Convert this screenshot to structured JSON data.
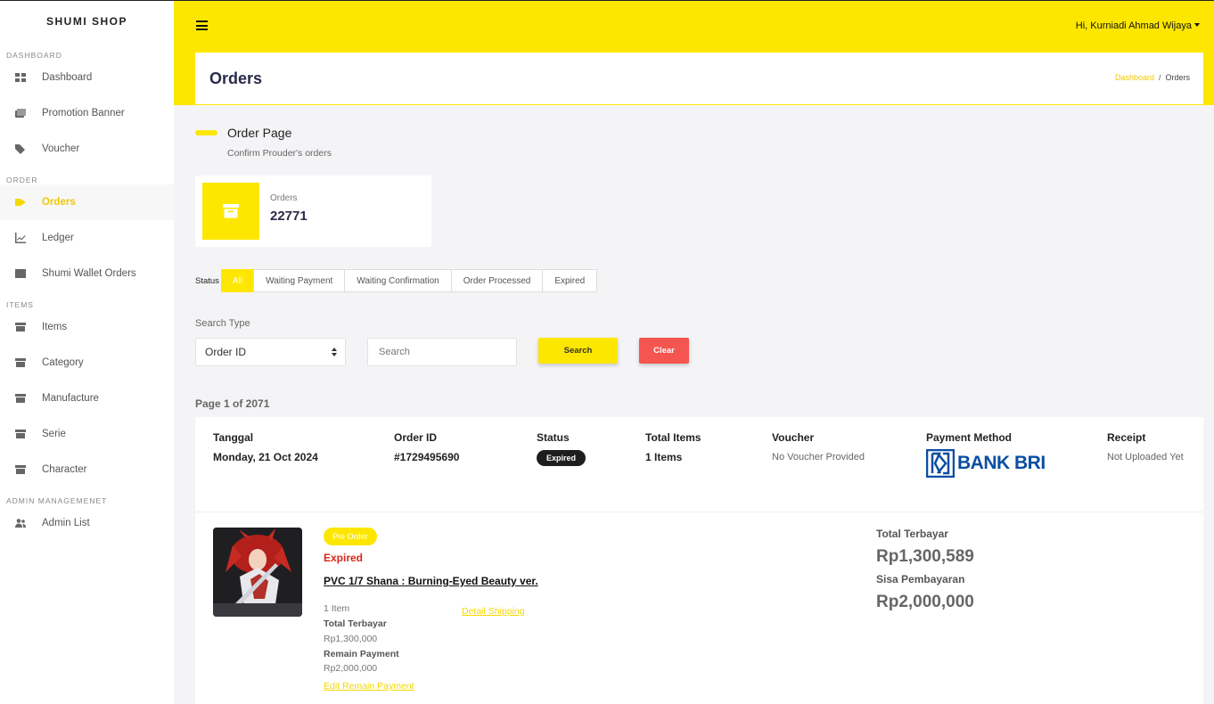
{
  "sidebar": {
    "brand": "SHUMI SHOP",
    "sections": {
      "dashboard": "DASHBOARD",
      "order": "ORDER",
      "items": "ITEMS",
      "admin": "ADMIN MANAGEMENET"
    },
    "items": {
      "dashboard": "Dashboard",
      "promotion_banner": "Promotion Banner",
      "voucher": "Voucher",
      "orders": "Orders",
      "ledger": "Ledger",
      "shumi_wallet_orders": "Shumi Wallet Orders",
      "items": "Items",
      "category": "Category",
      "manufacture": "Manufacture",
      "serie": "Serie",
      "character": "Character",
      "admin_list": "Admin List"
    }
  },
  "topbar": {
    "user_greeting": "Hi, Kurniadi Ahmad Wijaya"
  },
  "header": {
    "title": "Orders",
    "breadcrumb": {
      "home": "Dashboard",
      "sep": "/",
      "current": "Orders"
    }
  },
  "section": {
    "title": "Order Page",
    "subtitle": "Confirm Prouder's orders"
  },
  "stat": {
    "label": "Orders",
    "value": "22771"
  },
  "status_filter": {
    "label": "Status",
    "tabs": [
      "All",
      "Waiting Payment",
      "Waiting Confirmation",
      "Order Processed",
      "Expired"
    ],
    "selected": "All"
  },
  "search": {
    "type_label": "Search Type",
    "type_value": "Order ID",
    "placeholder": "Search",
    "search_button": "Search",
    "clear_button": "Clear"
  },
  "pagination": {
    "text": "Page 1 of 2071"
  },
  "order": {
    "headers": {
      "date": "Tanggal",
      "order_id": "Order ID",
      "status": "Status",
      "total_items": "Total Items",
      "voucher": "Voucher",
      "payment_method": "Payment Method",
      "receipt": "Receipt"
    },
    "values": {
      "date": "Monday, 21 Oct 2024",
      "order_id": "#1729495690",
      "status": "Expired",
      "total_items": "1 Items",
      "voucher": "No Voucher Provided",
      "payment_method": "BANK BRI",
      "receipt": "Not Uploaded Yet"
    },
    "item": {
      "badge": "Pre Order",
      "status": "Expired",
      "name": "PVC 1/7 Shana : Burning-Eyed Beauty ver.",
      "qty": "1 Item",
      "total_paid_label": "Total Terbayar",
      "total_paid_value": "Rp1,300,000",
      "remain_label": "Remain Payment",
      "remain_value": "Rp2,000,000",
      "detail_shipping": "Detail Shipping",
      "edit_remain": "Edit Remain Payment"
    },
    "summary": {
      "paid_label": "Total Terbayar",
      "paid_value": "Rp1,300,589",
      "remain_label": "Sisa Pembayaran",
      "remain_value": "Rp2,000,000"
    }
  },
  "colors": {
    "accent": "#fde700",
    "danger": "#f5554f",
    "bank": "#0a4ea1"
  }
}
